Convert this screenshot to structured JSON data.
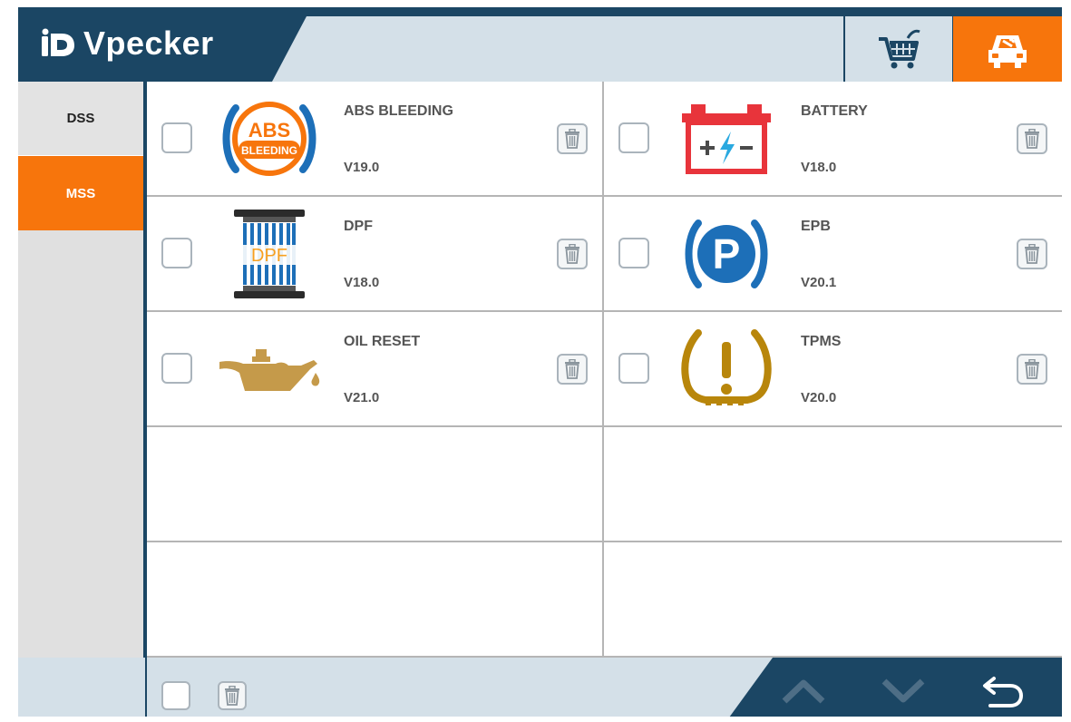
{
  "app": {
    "brand": "Vpecker"
  },
  "header": {
    "cart_icon": "cart-icon",
    "car_icon": "car-repair-icon",
    "accent": "#f7750c",
    "dark": "#1b4664"
  },
  "sidebar": {
    "items": [
      {
        "label": "DSS",
        "active": false
      },
      {
        "label": "MSS",
        "active": true
      }
    ]
  },
  "functions": [
    {
      "name": "ABS BLEEDING",
      "version": "V19.0",
      "icon": "abs-bleeding-icon",
      "icon_text": "ABS",
      "icon_subtext": "BLEEDING"
    },
    {
      "name": "BATTERY",
      "version": "V18.0",
      "icon": "battery-icon"
    },
    {
      "name": "DPF",
      "version": "V18.0",
      "icon": "dpf-filter-icon",
      "icon_text": "DPF"
    },
    {
      "name": "EPB",
      "version": "V20.1",
      "icon": "parking-brake-icon",
      "icon_text": "P"
    },
    {
      "name": "OIL RESET",
      "version": "V21.0",
      "icon": "oil-can-icon"
    },
    {
      "name": "TPMS",
      "version": "V20.0",
      "icon": "tire-pressure-icon"
    }
  ],
  "footer": {
    "select_all_icon": "checkbox",
    "delete_icon": "trash-icon",
    "up_icon": "chevron-up-icon",
    "down_icon": "chevron-down-icon",
    "back_icon": "back-arrow-icon"
  }
}
